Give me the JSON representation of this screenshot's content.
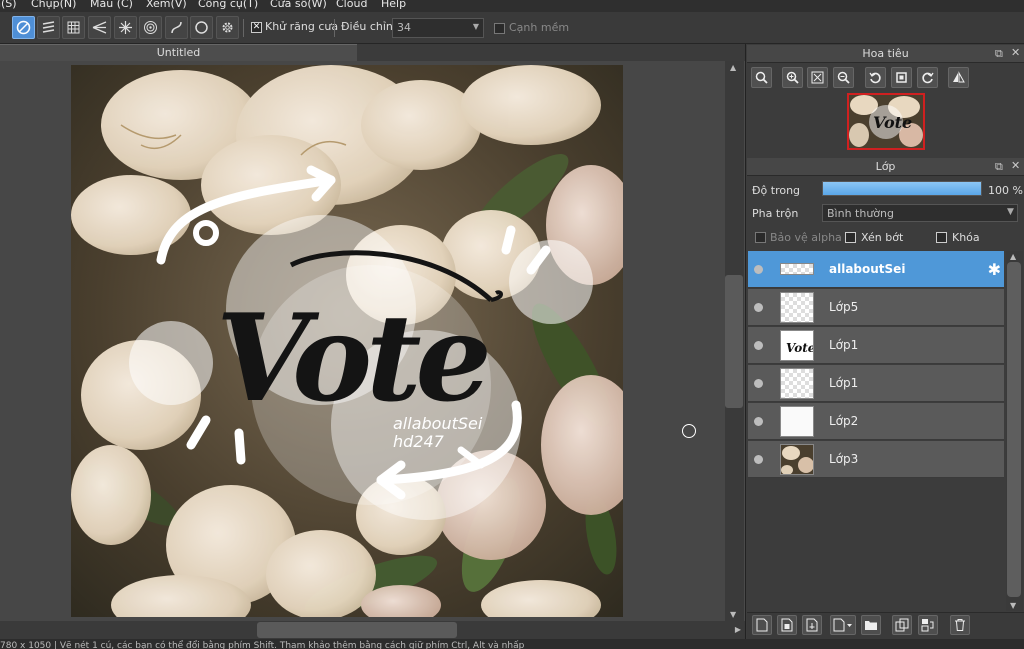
{
  "menu": [
    "n(S)",
    "Chụp(N)",
    "Màu (C)",
    "Xem(V)",
    "Công cụ(T)",
    "Cửa sổ(W)",
    "Cloud",
    "Help"
  ],
  "toolbar": {
    "antialias_label": "Khử răng cưa",
    "antialias_checked": true,
    "adjust_label": "Điều chỉnh",
    "adjust_value": "34",
    "soft_edge_label": "Cạnh mềm",
    "soft_edge_checked": false
  },
  "document": {
    "tab_title": "Untitled",
    "artwork_text": "Vote",
    "artwork_credit_1": "allaboutSei",
    "artwork_credit_2": "hd247"
  },
  "navigator": {
    "title": "Hoa tiêu"
  },
  "layers_panel": {
    "title": "Lớp",
    "opacity_label": "Độ trong",
    "opacity_value": "100 %",
    "opacity_fraction": 1.0,
    "blend_label": "Pha trộn",
    "blend_value": "Bình thường",
    "protect_alpha_label": "Bảo vệ alpha",
    "clip_label": "Xén bớt",
    "lock_label": "Khóa",
    "layers": [
      {
        "name": "allaboutSei",
        "selected": true,
        "thumb": "text"
      },
      {
        "name": "Lớp5",
        "selected": false,
        "thumb": "empty"
      },
      {
        "name": "Lớp1",
        "selected": false,
        "thumb": "vote"
      },
      {
        "name": "Lớp1",
        "selected": false,
        "thumb": "empty"
      },
      {
        "name": "Lớp2",
        "selected": false,
        "thumb": "empty-white"
      },
      {
        "name": "Lớp3",
        "selected": false,
        "thumb": "photo"
      }
    ]
  },
  "status_text": "780 x 1050 | Vẽ nét 1 cú, các bạn có thể đổi bằng phím Shift. Tham khảo thêm bằng cách giữ phím Ctrl, Alt và nhấp"
}
